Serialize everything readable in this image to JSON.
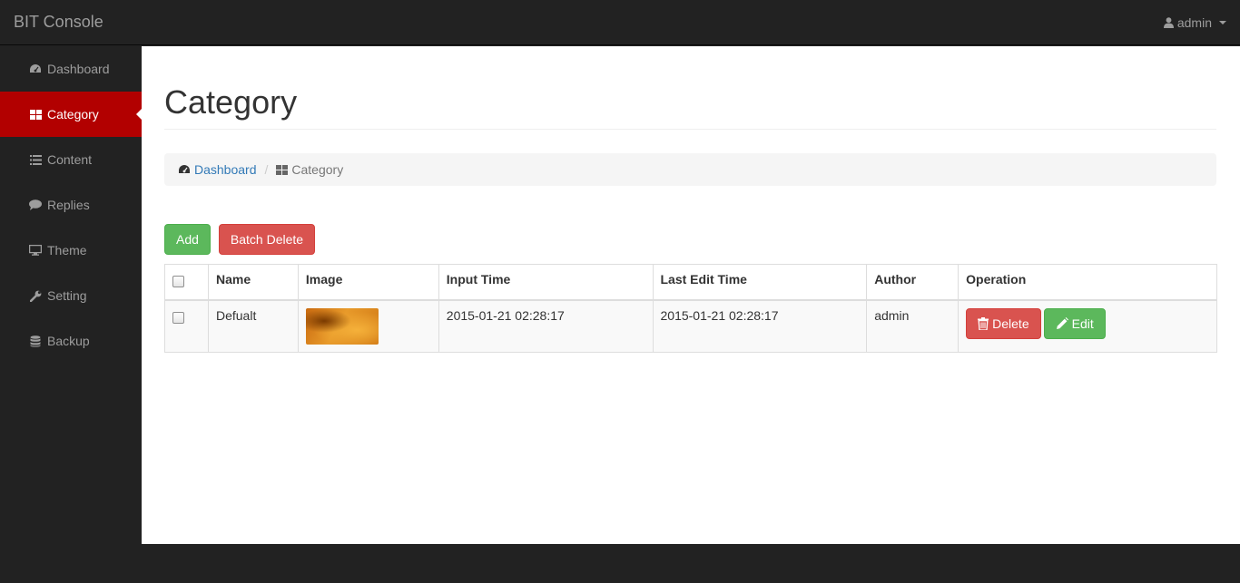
{
  "navbar": {
    "brand": "BIT Console",
    "user": "admin"
  },
  "sidebar": {
    "items": [
      {
        "label": "Dashboard",
        "icon": "dashboard-icon",
        "active": false
      },
      {
        "label": "Category",
        "icon": "th-large-icon",
        "active": true
      },
      {
        "label": "Content",
        "icon": "list-icon",
        "active": false
      },
      {
        "label": "Replies",
        "icon": "comment-icon",
        "active": false
      },
      {
        "label": "Theme",
        "icon": "monitor-icon",
        "active": false
      },
      {
        "label": "Setting",
        "icon": "wrench-icon",
        "active": false
      },
      {
        "label": "Backup",
        "icon": "database-icon",
        "active": false
      }
    ]
  },
  "page": {
    "title": "Category",
    "breadcrumb": {
      "home": "Dashboard",
      "separator": "/",
      "current": "Category"
    }
  },
  "actions": {
    "add": "Add",
    "batch_delete": "Batch Delete"
  },
  "table": {
    "columns": [
      "Name",
      "Image",
      "Input Time",
      "Last Edit Time",
      "Author",
      "Operation"
    ],
    "rows": [
      {
        "name": "Defualt",
        "input_time": "2015-01-21 02:28:17",
        "last_edit_time": "2015-01-21 02:28:17",
        "author": "admin",
        "delete_label": "Delete",
        "edit_label": "Edit"
      }
    ]
  },
  "colors": {
    "navbar_bg": "#222222",
    "active_item": "#b20000",
    "success": "#5cb85c",
    "danger": "#d9534f",
    "link": "#337ab7"
  }
}
